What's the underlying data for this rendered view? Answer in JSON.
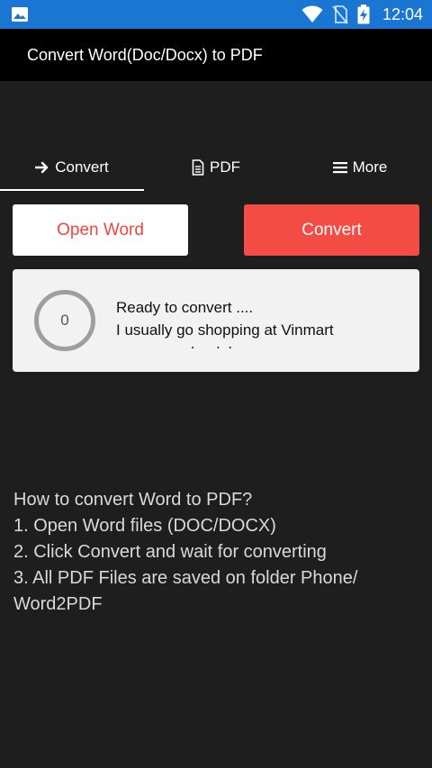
{
  "status_bar": {
    "time": "12:04",
    "icons": [
      "image-icon",
      "wifi-icon",
      "no-sim-icon",
      "battery-charging-icon"
    ],
    "color": "#1976d2"
  },
  "app_bar": {
    "title": "Convert Word(Doc/Docx) to PDF"
  },
  "tabs": [
    {
      "label": "Convert",
      "icon": "arrow-right-icon",
      "active": true
    },
    {
      "label": "PDF",
      "icon": "document-icon",
      "active": false
    },
    {
      "label": "More",
      "icon": "menu-icon",
      "active": false
    }
  ],
  "buttons": {
    "open_word": "Open Word",
    "convert": "Convert"
  },
  "progress": {
    "value": "0",
    "status": "Ready to convert ....",
    "line2": "I usually go shopping at Vinmart",
    "line3": "near my school, because"
  },
  "instructions": {
    "title": "How to convert Word to PDF?",
    "step1": "1. Open Word files (DOC/DOCX)",
    "step2": "2. Click Convert and wait for converting",
    "step3a": "3. All PDF Files are saved on folder Phone/",
    "step3b": "Word2PDF"
  },
  "colors": {
    "accent": "#f44c45",
    "background": "#1e1e1e",
    "app_bar": "#000000"
  }
}
